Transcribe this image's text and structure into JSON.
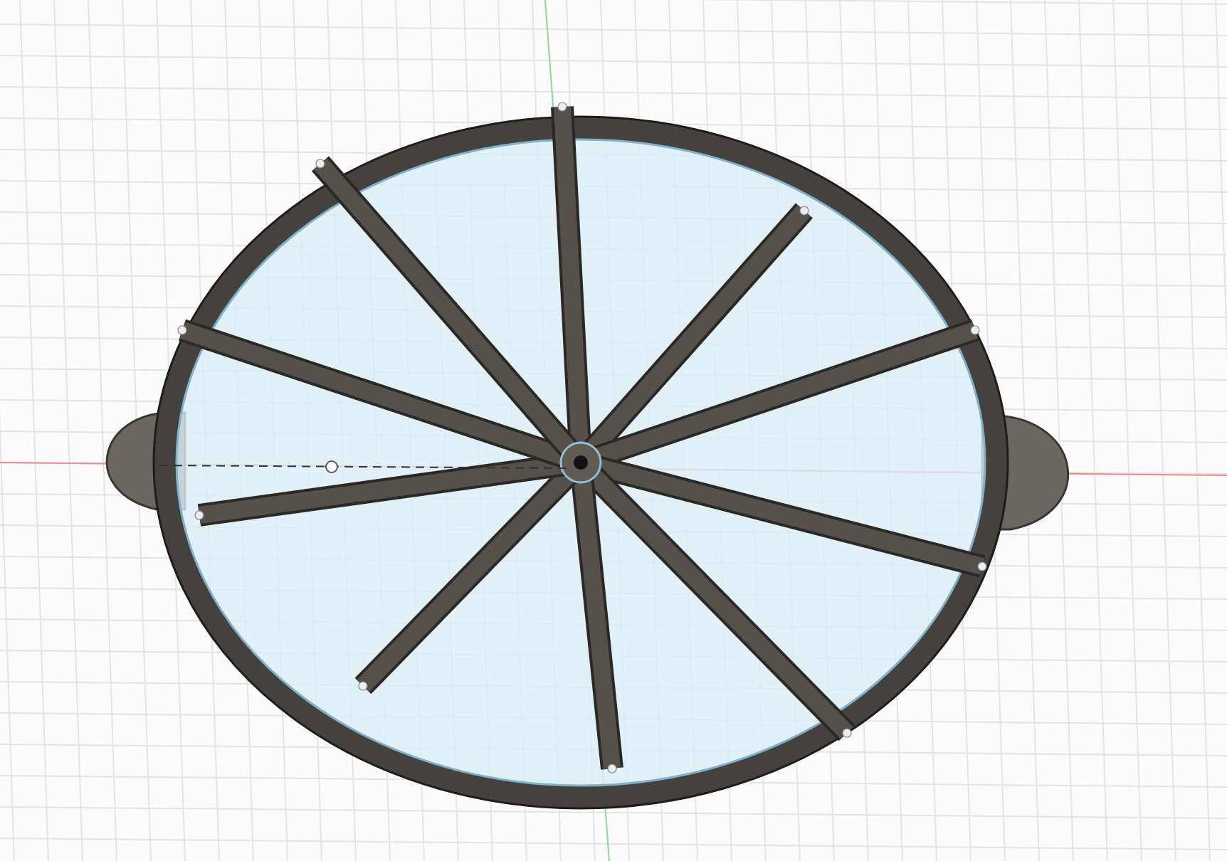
{
  "viewport": {
    "kind": "model"
  }
}
